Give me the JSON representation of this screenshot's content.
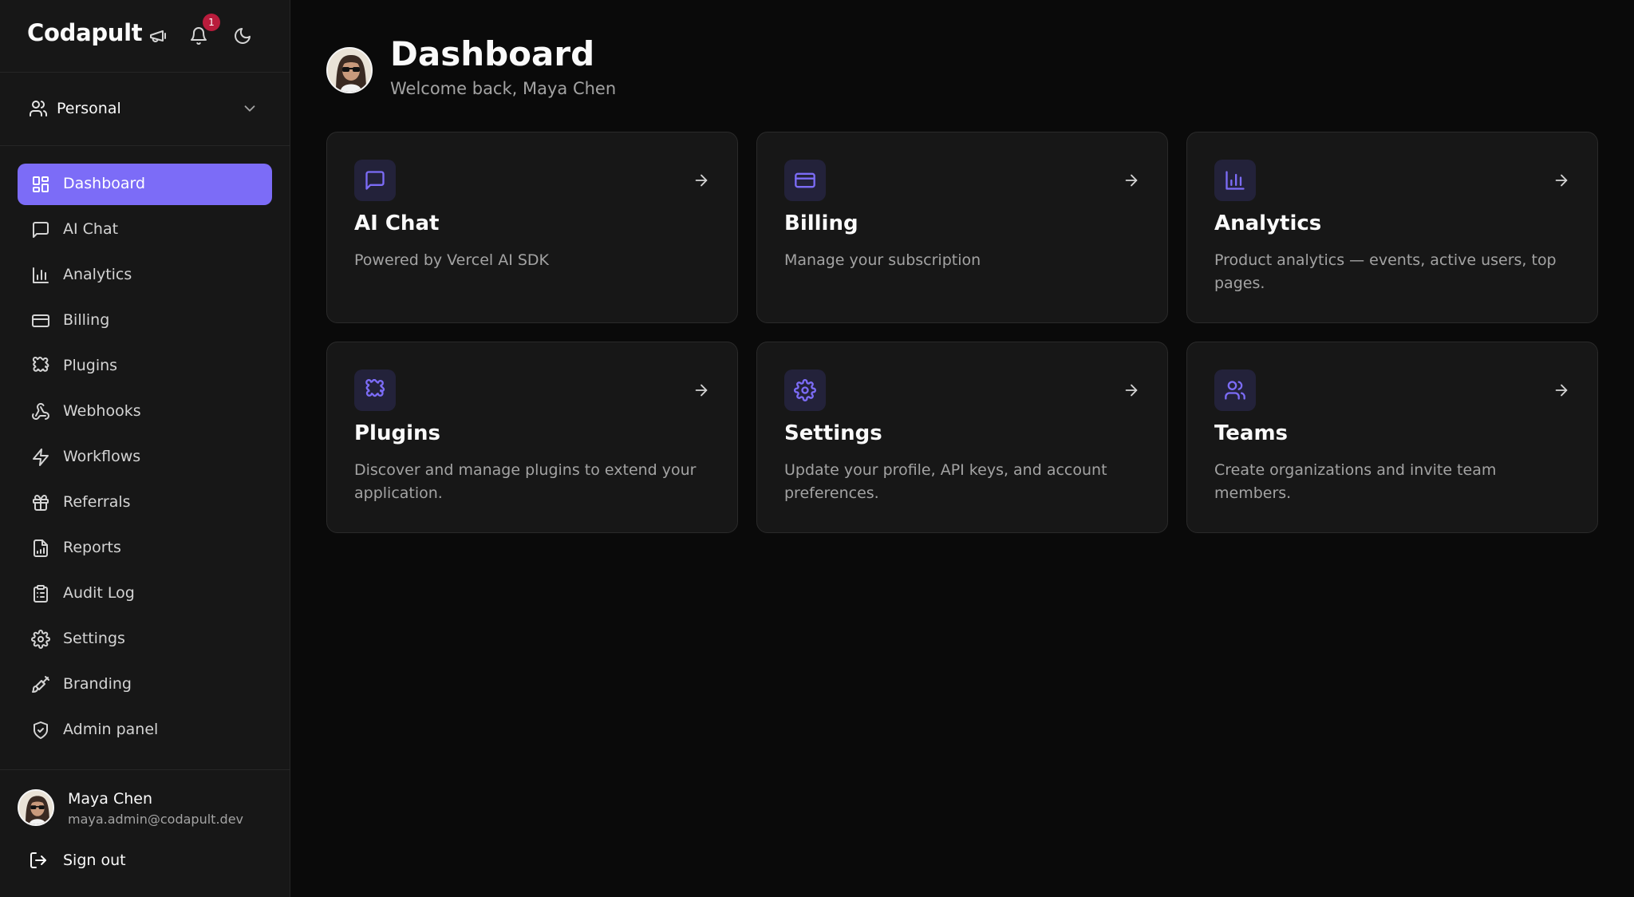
{
  "app": {
    "brand": "Codapult"
  },
  "topbar": {
    "notification_count": "1"
  },
  "workspace": {
    "label": "Personal"
  },
  "sidebar": {
    "items": [
      {
        "label": "Dashboard",
        "icon": "dashboard-icon",
        "active": true
      },
      {
        "label": "AI Chat",
        "icon": "chat-icon"
      },
      {
        "label": "Analytics",
        "icon": "bar-chart-icon"
      },
      {
        "label": "Billing",
        "icon": "credit-card-icon"
      },
      {
        "label": "Plugins",
        "icon": "puzzle-icon"
      },
      {
        "label": "Webhooks",
        "icon": "webhook-icon"
      },
      {
        "label": "Workflows",
        "icon": "zap-icon"
      },
      {
        "label": "Referrals",
        "icon": "gift-icon"
      },
      {
        "label": "Reports",
        "icon": "report-icon"
      },
      {
        "label": "Audit Log",
        "icon": "clipboard-icon"
      },
      {
        "label": "Settings",
        "icon": "gear-icon"
      },
      {
        "label": "Branding",
        "icon": "brush-icon"
      },
      {
        "label": "Admin panel",
        "icon": "shield-icon"
      }
    ]
  },
  "user": {
    "name": "Maya Chen",
    "email": "maya.admin@codapult.dev",
    "signout_label": "Sign out"
  },
  "header": {
    "title": "Dashboard",
    "subtitle": "Welcome back, Maya Chen"
  },
  "cards": [
    {
      "title": "AI Chat",
      "description": "Powered by Vercel AI SDK",
      "icon": "chat-icon"
    },
    {
      "title": "Billing",
      "description": "Manage your subscription",
      "icon": "credit-card-icon"
    },
    {
      "title": "Analytics",
      "description": "Product analytics — events, active users, top pages.",
      "icon": "bar-chart-icon"
    },
    {
      "title": "Plugins",
      "description": "Discover and manage plugins to extend your application.",
      "icon": "puzzle-icon"
    },
    {
      "title": "Settings",
      "description": "Update your profile, API keys, and account preferences.",
      "icon": "gear-icon"
    },
    {
      "title": "Teams",
      "description": "Create organizations and invite team members.",
      "icon": "users-icon"
    }
  ],
  "colors": {
    "accent": "#7c6cf7",
    "background": "#0a0a0a",
    "sidebar": "#171717",
    "card": "#171717",
    "badge": "#b91c3c"
  }
}
